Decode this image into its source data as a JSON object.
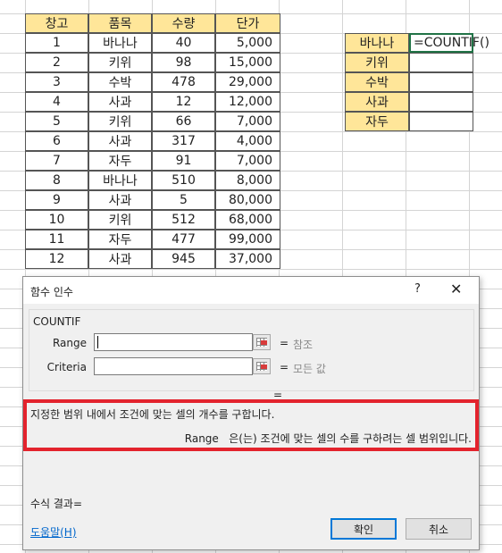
{
  "table": {
    "headers": [
      "창고",
      "품목",
      "수량",
      "단가"
    ],
    "rows": [
      [
        "1",
        "바나나",
        "40",
        "5,000"
      ],
      [
        "2",
        "키위",
        "98",
        "15,000"
      ],
      [
        "3",
        "수박",
        "478",
        "29,000"
      ],
      [
        "4",
        "사과",
        "12",
        "12,000"
      ],
      [
        "5",
        "키위",
        "66",
        "7,000"
      ],
      [
        "6",
        "사과",
        "317",
        "4,000"
      ],
      [
        "7",
        "자두",
        "91",
        "7,000"
      ],
      [
        "8",
        "바나나",
        "510",
        "8,000"
      ],
      [
        "9",
        "사과",
        "5",
        "80,000"
      ],
      [
        "10",
        "키위",
        "512",
        "68,000"
      ],
      [
        "11",
        "자두",
        "477",
        "99,000"
      ],
      [
        "12",
        "사과",
        "945",
        "37,000"
      ]
    ]
  },
  "lookup": {
    "labels": [
      "바나나",
      "키위",
      "수박",
      "사과",
      "자두"
    ],
    "formula": "=COUNTIF()"
  },
  "dialog": {
    "title": "함수 인수",
    "help_symbol": "?",
    "close_symbol": "✕",
    "function_name": "COUNTIF",
    "args": [
      {
        "label": "Range",
        "value": "",
        "equals": "=",
        "hint": "참조"
      },
      {
        "label": "Criteria",
        "value": "",
        "equals": "=",
        "hint": "모든 값"
      }
    ],
    "result_equals": "=",
    "description": "지정한 범위 내에서 조건에 맞는 셀의 개수를 구합니다.",
    "arg_help_name": "Range",
    "arg_help_text": "은(는) 조건에 맞는 셀의 수를 구하려는 셀 범위입니다.",
    "formula_result_label": "수식 결과=",
    "help_link": "도움말(H)",
    "ok_label": "확인",
    "cancel_label": "취소"
  },
  "colors": {
    "header_fill": "#ffe699",
    "highlight_border": "#e3232d",
    "active_cell_border": "#217346",
    "link": "#0066cc"
  },
  "icons": [
    "range-reference-icon",
    "close-icon",
    "help-icon"
  ]
}
